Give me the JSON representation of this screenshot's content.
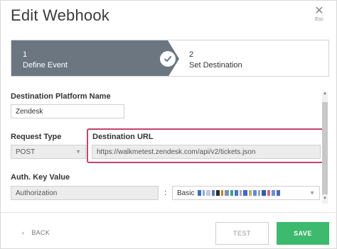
{
  "dialog": {
    "title": "Edit Webhook",
    "close_label": "Esc"
  },
  "stepper": {
    "steps": [
      {
        "number": "1",
        "label": "Define Event",
        "completed": true
      },
      {
        "number": "2",
        "label": "Set Destination",
        "completed": false
      }
    ],
    "active_color": "#6b7681"
  },
  "form": {
    "platform_label": "Destination Platform Name",
    "platform_value": "Zendesk",
    "request_type_label": "Request Type",
    "request_type_value": "POST",
    "destination_url_label": "Destination URL",
    "destination_url_value": "https://walkmetest.zendesk.com/api/v2/tickets.json",
    "auth_label": "Auth. Key Value",
    "auth_key": "Authorization",
    "auth_separator": ":",
    "auth_value_prefix": "Basic",
    "highlight_color": "#c4426e"
  },
  "footer": {
    "back_label": "BACK",
    "test_label": "TEST",
    "save_label": "SAVE",
    "save_color": "#3dba6d"
  },
  "icons": {
    "close": "close-icon",
    "check": "check-icon",
    "back": "chevron-left-icon",
    "select": "chevron-down-icon"
  }
}
